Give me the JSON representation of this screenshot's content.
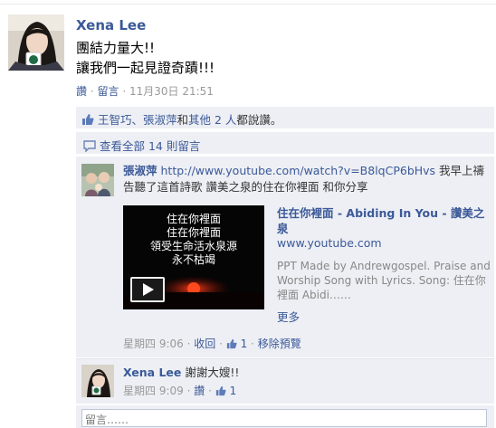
{
  "post": {
    "author": "Xena Lee",
    "line1": "團結力量大!!",
    "line2": "讓我們一起見證奇蹟!!!",
    "like_link": "讚",
    "comment_link": "留言",
    "timestamp": "11月30日 21:51"
  },
  "likes": {
    "names": "王智巧、張淑萍",
    "and": "和",
    "others": "其他 2 人",
    "suffix": "都說讚。"
  },
  "view_all": "查看全部 14 則留言",
  "comments": [
    {
      "author": "張淑萍",
      "url": "http://www.youtube.com/watch?v=B8lqCP6bHvs",
      "text_after": " 我早上禱告聽了這首詩歌 讚美之泉的住在你裡面 和你分享",
      "share": {
        "thumb_text": "住在你裡面\n住在你裡面\n領受生命活水泉源\n永不枯竭",
        "title": "住在你裡面 - Abiding In You - 讚美之泉",
        "domain": "www.youtube.com",
        "description": "PPT Made by Andrewgospel. Praise and Worship Song with Lyrics. Song: 住在你裡面 Abidi……",
        "more": "更多"
      },
      "time": "星期四 9:06",
      "action1": "收回",
      "like_count": "1",
      "action2": "移除預覽"
    },
    {
      "author": "Xena Lee",
      "text": "謝謝大嫂!!",
      "time": "星期四 9:09",
      "like_link": "讚",
      "like_count": "1"
    }
  ],
  "reply_placeholder": "留言……",
  "colors": {
    "link": "#3b5998",
    "panel": "#edeff4",
    "meta": "#999999"
  }
}
